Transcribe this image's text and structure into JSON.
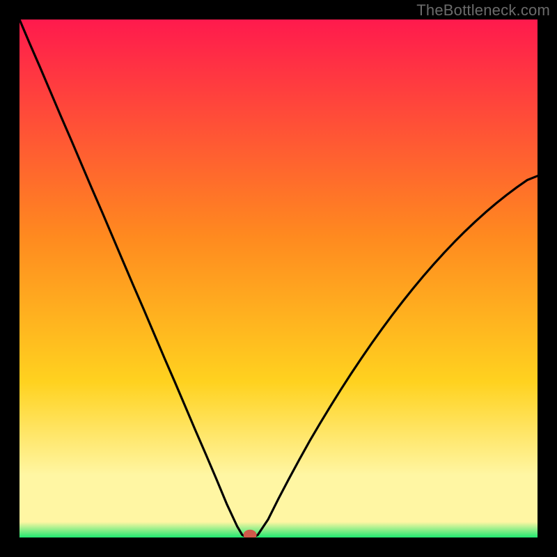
{
  "watermark": "TheBottleneck.com",
  "colors": {
    "frame": "#000000",
    "watermark_text": "#6b6b6b",
    "gradient_top": "#ff1a4d",
    "gradient_mid1": "#ff8a1f",
    "gradient_mid2": "#ffd21f",
    "gradient_band": "#fff6a3",
    "gradient_bottom": "#1fe870",
    "curve": "#000000",
    "marker_fill": "#cf5a4a",
    "marker_stroke": "#cf5a4a"
  },
  "chart_data": {
    "type": "line",
    "title": "",
    "xlabel": "",
    "ylabel": "",
    "xlim": [
      0,
      100
    ],
    "ylim": [
      0,
      100
    ],
    "grid": false,
    "legend": false,
    "x": [
      0,
      2,
      4,
      6,
      8,
      10,
      12,
      14,
      16,
      18,
      20,
      22,
      24,
      26,
      28,
      30,
      32,
      34,
      36,
      38,
      40,
      42,
      43,
      44,
      45,
      46,
      48,
      50,
      52,
      54,
      56,
      58,
      60,
      62,
      64,
      66,
      68,
      70,
      72,
      74,
      76,
      78,
      80,
      82,
      84,
      86,
      88,
      90,
      92,
      94,
      96,
      98,
      100
    ],
    "y": [
      100,
      95.3,
      90.7,
      86.0,
      81.3,
      76.7,
      72.0,
      67.3,
      62.7,
      58.0,
      53.3,
      48.6,
      44.0,
      39.3,
      34.6,
      30.0,
      25.3,
      20.6,
      16.0,
      11.3,
      6.5,
      2.2,
      0.5,
      0.0,
      0.0,
      0.5,
      3.5,
      7.5,
      11.3,
      15.0,
      18.6,
      22.0,
      25.3,
      28.5,
      31.6,
      34.6,
      37.5,
      40.3,
      43.0,
      45.6,
      48.1,
      50.5,
      52.8,
      55.0,
      57.1,
      59.1,
      61.0,
      62.8,
      64.5,
      66.1,
      67.6,
      69.0,
      69.8
    ],
    "marker": {
      "x": 44.5,
      "y": 0.5
    }
  }
}
